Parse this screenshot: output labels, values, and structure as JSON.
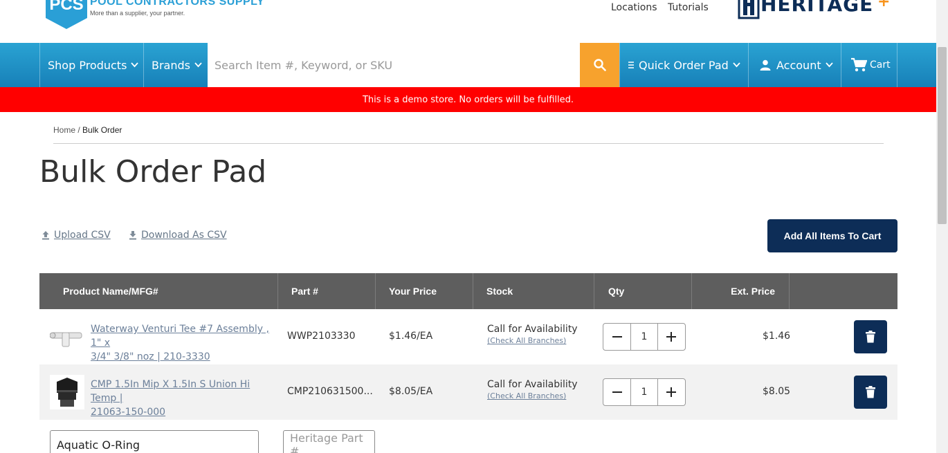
{
  "header": {
    "logo_mark": "PCS",
    "brand_name": "POOL CONTRACTORS SUPPLY",
    "tagline": "More than a supplier, your partner.",
    "links": [
      "Locations",
      "Tutorials"
    ],
    "partner_brand": "HERITAGE",
    "partner_plus": "+"
  },
  "nav": {
    "shop_products": "Shop Products",
    "brands": "Brands",
    "search_placeholder": "Search Item #, Keyword, or SKU",
    "quick_order_pad": "Quick Order Pad",
    "account": "Account",
    "cart": "Cart"
  },
  "banner": "This is a demo store. No orders will be fulfilled.",
  "breadcrumb": {
    "home": "Home",
    "separator": " / ",
    "current": "Bulk Order"
  },
  "page_title": "Bulk Order Pad",
  "actions": {
    "upload_csv": "Upload CSV",
    "download_csv": "Download As CSV",
    "add_all": "Add All Items To Cart"
  },
  "table": {
    "headers": [
      "Product Name/MFG#",
      "Part #",
      "Your Price",
      "Stock",
      "Qty",
      "Ext. Price"
    ],
    "rows": [
      {
        "name_line1": "Waterway Venturi Tee #7 Assembly , 1\" x",
        "name_line2": "3/4\" 3/8\" noz | 210-3330",
        "part": "WWP2103330",
        "price": "$1.46/EA",
        "stock": "Call for Availability",
        "stock_link": "(Check All Branches)",
        "qty": "1",
        "ext_price": "$1.46"
      },
      {
        "name_line1": "CMP 1.5In Mip X 1.5In S Union Hi Temp |",
        "name_line2": "21063-150-000",
        "part": "CMP210631500...",
        "price": "$8.05/EA",
        "stock": "Call for Availability",
        "stock_link": "(Check All Branches)",
        "qty": "1",
        "ext_price": "$8.05"
      }
    ],
    "entry": {
      "product_value": "Aquatic O-Ring",
      "part_placeholder": "Heritage Part #"
    }
  },
  "colors": {
    "nav_top": "#2aa3d3",
    "nav_bottom": "#1780b8",
    "search_button": "#f7a22d",
    "banner": "#ff0000",
    "navy": "#0d2d57",
    "table_header": "#5e5e5e"
  }
}
